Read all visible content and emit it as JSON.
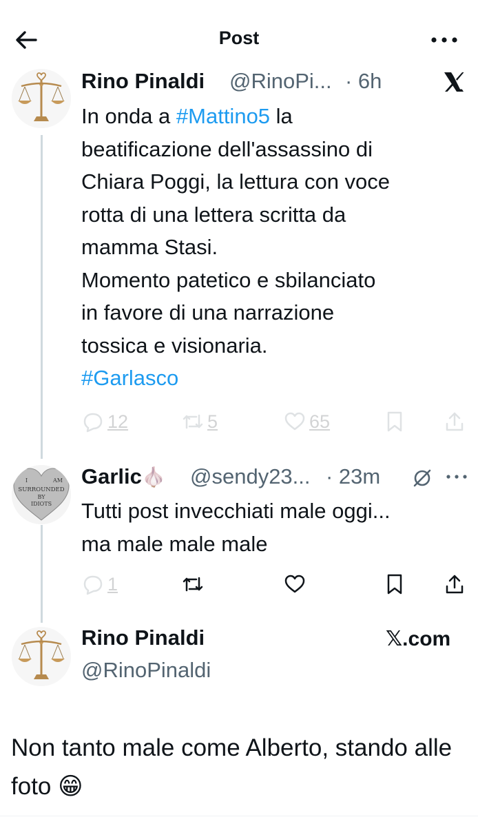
{
  "header": {
    "title": "Post"
  },
  "tweet1": {
    "name": "Rino Pinaldi",
    "handle": "@RinoPi...",
    "time": "· 6h",
    "text_part1": "In onda a ",
    "hashtag1": "#Mattino5",
    "text_part2": " la\nbeatificazione dell'assassino di\nChiara Poggi, la lettura con voce\nrotta di una lettera scritta da\nmamma Stasi.\nMomento patetico e sbilanciato\nin favore di una narrazione\ntossica e visionaria.\n",
    "hashtag2": "#Garlasco",
    "replies": "12",
    "reposts": "5",
    "likes": "65"
  },
  "tweet2": {
    "name": "Garlic",
    "name_emoji": "🧄",
    "handle": "@sendy23...",
    "time": "· 23m",
    "text": "Tutti post invecchiati male oggi...\nma male male male",
    "replies": "1",
    "avatar_text": "I AM SURROUNDED BY IDIOTS"
  },
  "tweet3": {
    "name": "Rino Pinaldi",
    "handle": "@RinoPinaldi",
    "source": "𝕏.com"
  },
  "reply": {
    "text": "Non tanto male come Alberto, stando alle foto ",
    "emoji": "😁"
  },
  "icons": {
    "back": "arrow-left-icon",
    "more": "more-horizontal-icon",
    "x_logo": "x-logo-icon",
    "reply": "comment-icon",
    "repost": "repost-icon",
    "like": "heart-icon",
    "bookmark": "bookmark-icon",
    "share": "share-icon",
    "grok": "grok-icon"
  },
  "colors": {
    "text": "#0f1419",
    "secondary": "#536471",
    "accent": "#1d9bf0",
    "line": "#cfd9de"
  }
}
